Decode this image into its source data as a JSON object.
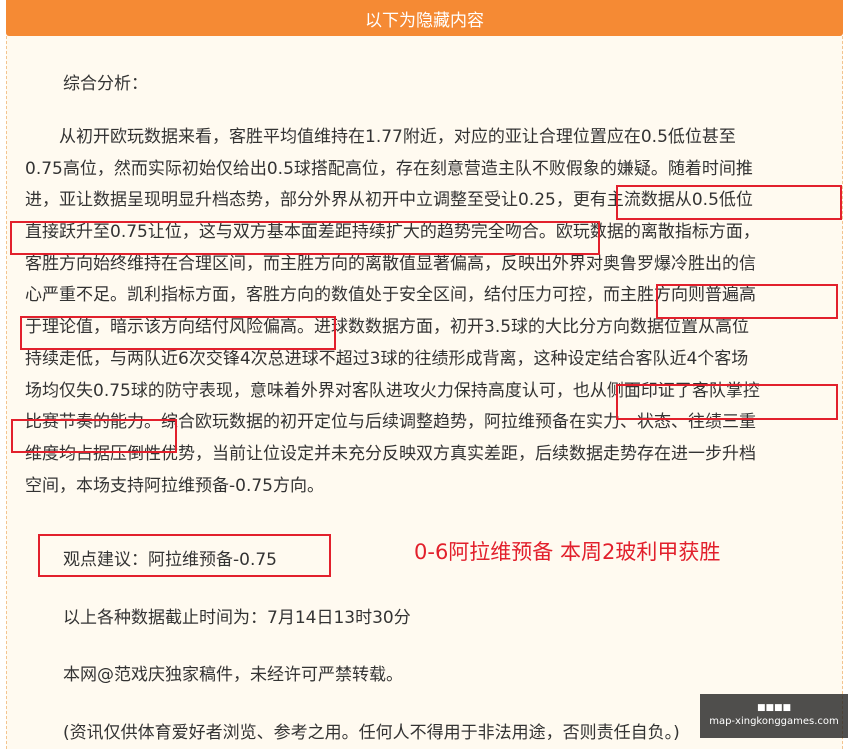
{
  "header": {
    "title": "以下为隐藏内容"
  },
  "article": {
    "section_title": "综合分析：",
    "lines": [
      "　　从初开欧玩数据来看，客胜平均值维持在1.77附近，对应的亚让合理位置应在0.5低位甚至",
      "0.75高位，然而实际初始仅给出0.5球搭配高位，存在刻意营造主队不败假象的嫌疑。随着时间推",
      "进，亚让数据呈现明显升档态势，部分外界从初开中立调整至受让0.25，更有主流数据从0.5低位",
      "直接跃升至0.75让位，这与双方基本面差距持续扩大的趋势完全吻合。欧玩数据的离散指标方面，",
      "客胜方向始终维持在合理区间，而主胜方向的离散值显著偏高，反映出外界对奥鲁罗爆冷胜出的信",
      "心严重不足。凯利指标方面，客胜方向的数值处于安全区间，结付压力可控，而主胜方向则普遍高",
      "于理论值，暗示该方向结付风险偏高。进球数数据方面，初开3.5球的大比分方向数据位置从高位",
      "持续走低，与两队近6次交锋4次总进球不超过3球的往绩形成背离，这种设定结合客队近4个客场",
      "场均仅失0.75球的防守表现，意味着外界对客队进攻火力保持高度认可，也从侧面印证了客队掌控",
      "比赛节奏的能力。综合欧玩数据的初开定位与后续调整趋势，阿拉维预备在实力、状态、往绩三重",
      "维度均占据压倒性优势，当前让位设定并未充分反映双方真实差距，后续数据走势存在进一步升档",
      "空间，本场支持阿拉维预备-0.75方向。"
    ],
    "recommendation": "观点建议：阿拉维预备-0.75",
    "result_note": "0-6阿拉维预备 本周2玻利甲获胜",
    "cutoff": "以上各种数据截止时间为：7月14日13时30分",
    "copyright": "本网@范戏庆独家稿件，未经许可严禁转载。",
    "disclaimer": "(资讯仅供体育爱好者浏览、参考之用。任何人不得用于非法用途，否则责任自负。)"
  },
  "watermark": {
    "text": "map-xingkonggames.com"
  },
  "colors": {
    "header": "#f58a34",
    "highlight_border": "#e2202c",
    "panel_bg": "#fffaf0"
  }
}
